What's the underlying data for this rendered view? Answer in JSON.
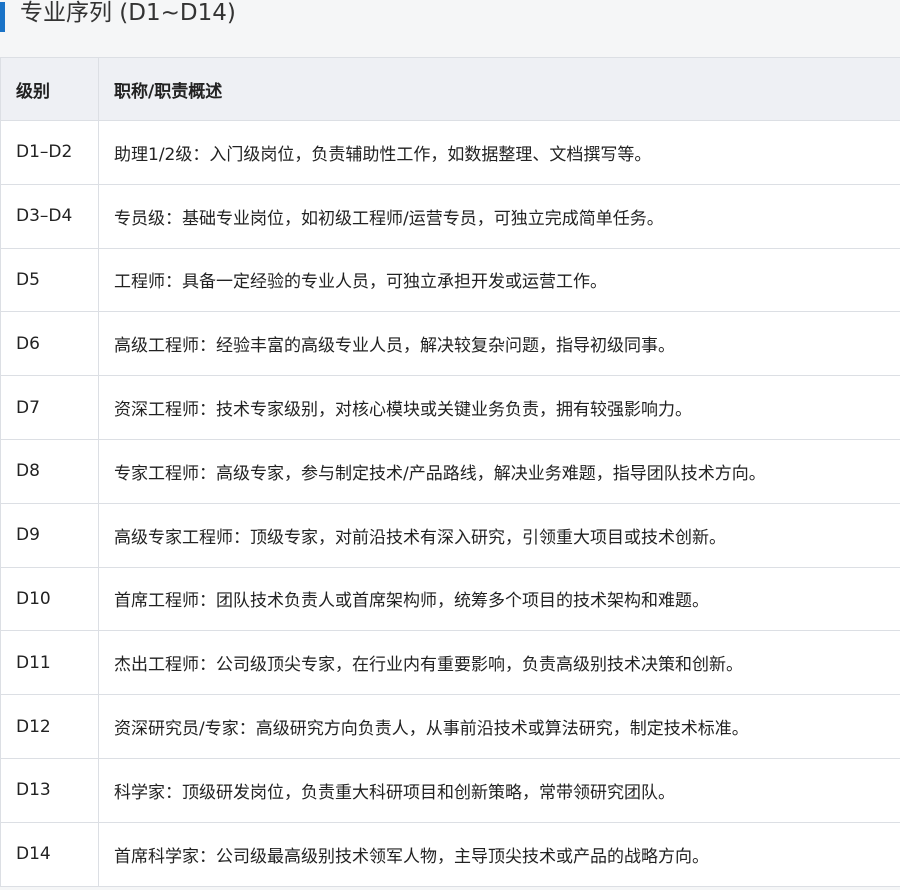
{
  "section": {
    "title": "专业序列 (D1~D14)"
  },
  "table": {
    "headers": [
      "级别",
      "职称/职责概述"
    ],
    "rows": [
      {
        "level": "D1–D2",
        "desc": "助理1/2级：入门级岗位，负责辅助性工作，如数据整理、文档撰写等。"
      },
      {
        "level": "D3–D4",
        "desc": "专员级：基础专业岗位，如初级工程师/运营专员，可独立完成简单任务。"
      },
      {
        "level": "D5",
        "desc": "工程师：具备一定经验的专业人员，可独立承担开发或运营工作。"
      },
      {
        "level": "D6",
        "desc": "高级工程师：经验丰富的高级专业人员，解决较复杂问题，指导初级同事。"
      },
      {
        "level": "D7",
        "desc": "资深工程师：技术专家级别，对核心模块或关键业务负责，拥有较强影响力。"
      },
      {
        "level": "D8",
        "desc": "专家工程师：高级专家，参与制定技术/产品路线，解决业务难题，指导团队技术方向。"
      },
      {
        "level": "D9",
        "desc": "高级专家工程师：顶级专家，对前沿技术有深入研究，引领重大项目或技术创新。"
      },
      {
        "level": "D10",
        "desc": "首席工程师：团队技术负责人或首席架构师，统筹多个项目的技术架构和难题。"
      },
      {
        "level": "D11",
        "desc": "杰出工程师：公司级顶尖专家，在行业内有重要影响，负责高级别技术决策和创新。"
      },
      {
        "level": "D12",
        "desc": "资深研究员/专家：高级研究方向负责人，从事前沿技术或算法研究，制定技术标准。"
      },
      {
        "level": "D13",
        "desc": "科学家：顶级研发岗位，负责重大科研项目和创新策略，常带领研究团队。"
      },
      {
        "level": "D14",
        "desc": "首席科学家：公司级最高级别技术领军人物，主导顶尖技术或产品的战略方向。"
      }
    ]
  },
  "colors": {
    "accent": "#1a73c7",
    "header_bg": "#eef0f4",
    "border": "#dcdfe4",
    "page_bg": "#f5f6f7"
  }
}
